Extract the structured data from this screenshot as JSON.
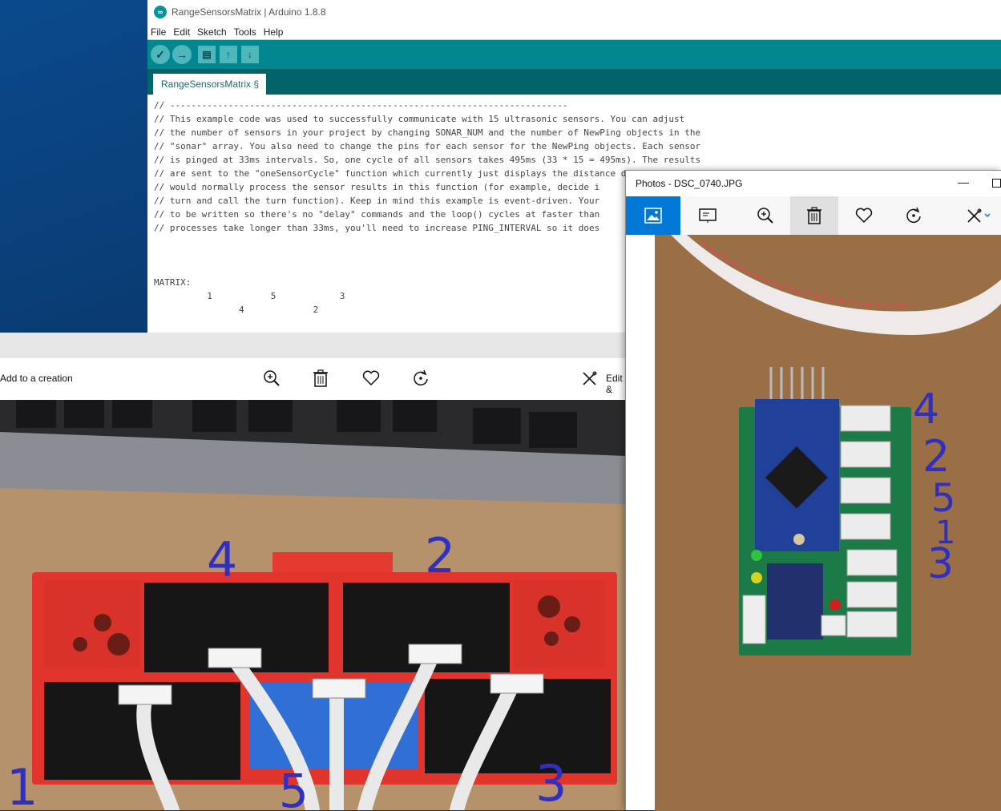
{
  "arduino": {
    "title": "RangeSensorsMatrix | Arduino 1.8.8",
    "logo": "∞",
    "menu": [
      "File",
      "Edit",
      "Sketch",
      "Tools",
      "Help"
    ],
    "tab": "RangeSensorsMatrix §",
    "code_lines": [
      "// ---------------------------------------------------------------------------",
      "// This example code was used to successfully communicate with 15 ultrasonic sensors. You can adjust",
      "// the number of sensors in your project by changing SONAR_NUM and the number of NewPing objects in the",
      "// \"sonar\" array. You also need to change the pins for each sensor for the NewPing objects. Each sensor",
      "// is pinged at 33ms intervals. So, one cycle of all sensors takes 495ms (33 * 15 = 495ms). The results",
      "// are sent to the \"oneSensorCycle\" function which currently just displays the distance data. Your project",
      "// would normally process the sensor results in this function (for example, decide i",
      "// turn and call the turn function). Keep in mind this example is event-driven. Your",
      "// to be written so there's no \"delay\" commands and the loop() cycles at faster than",
      "// processes take longer than 33ms, you'll need to increase PING_INTERVAL so it does",
      "",
      "",
      "",
      "MATRIX:",
      "          1           5            3",
      "                4             2"
    ]
  },
  "photos_back": {
    "add_label": "Add to a creation",
    "edit_label": "Edit &"
  },
  "photos_front": {
    "title": "Photos - DSC_0740.JPG",
    "minimize": "—"
  },
  "labels_back": [
    "4",
    "2",
    "1",
    "5",
    "3"
  ],
  "labels_front": [
    "4",
    "2",
    "5",
    "1",
    "3"
  ],
  "colors": {
    "teal": "#00878f",
    "accent": "#0078d7",
    "ink": "#2f2fc0"
  }
}
